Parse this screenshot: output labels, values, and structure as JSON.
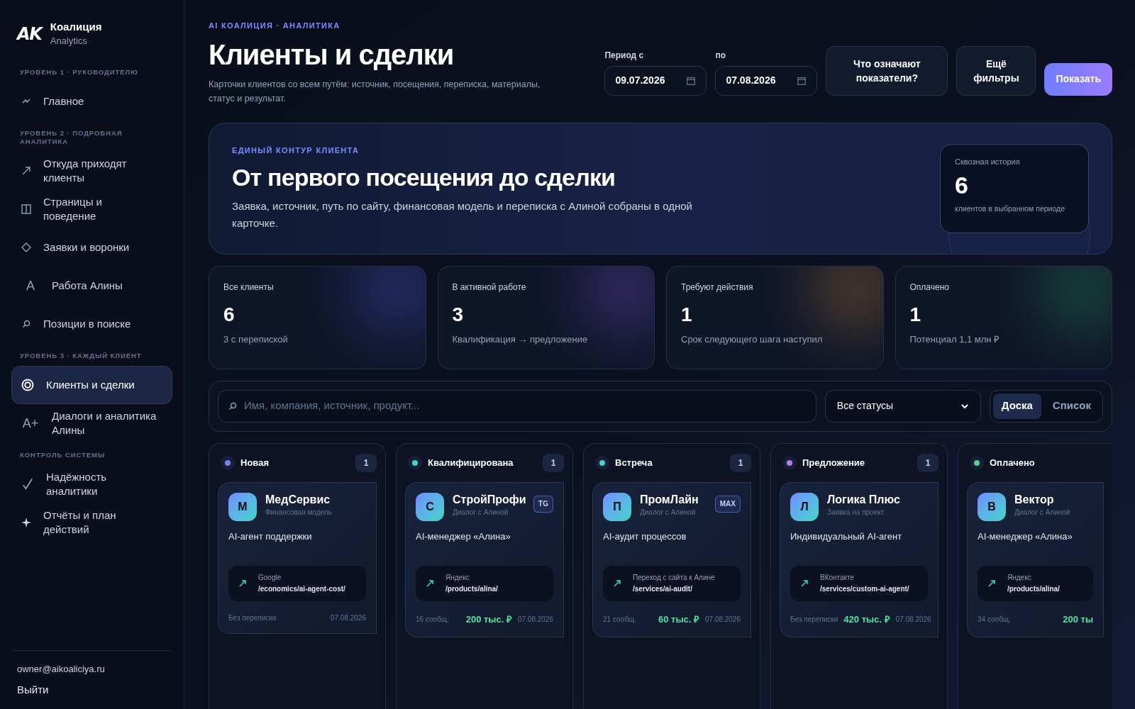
{
  "brand": {
    "logo": "AK",
    "name": "Коалиция",
    "subtitle": "Analytics"
  },
  "sidebar": {
    "sections": [
      {
        "title": "УРОВЕНЬ 1 · РУКОВОДИТЕЛЮ",
        "items": [
          {
            "label": "Главное",
            "selected": false
          }
        ]
      },
      {
        "title": "УРОВЕНЬ 2 · ПОДРОБНАЯ АНАЛИТИКА",
        "items": [
          {
            "label": "Откуда приходят клиенты",
            "selected": false
          },
          {
            "label": "Страницы и поведение",
            "selected": false
          },
          {
            "label": "Заявки и воронки",
            "selected": false
          },
          {
            "glyph": "A",
            "label": "Работа Алины",
            "selected": false
          },
          {
            "label": "Позиции в поиске",
            "selected": false
          }
        ]
      },
      {
        "title": "УРОВЕНЬ 3 · КАЖДЫЙ КЛИЕНТ",
        "items": [
          {
            "label": "Клиенты и сделки",
            "selected": true
          },
          {
            "glyph": "A+",
            "label": "Диалоги и аналитика Алины",
            "selected": false
          }
        ]
      },
      {
        "title": "КОНТРОЛЬ СИСТЕМЫ",
        "items": [
          {
            "label": "Надёжность аналитики",
            "selected": false
          },
          {
            "label": "Отчёты и план действий",
            "selected": false
          }
        ]
      }
    ],
    "user_email": "owner@aikoaliciya.ru",
    "logout": "Выйти"
  },
  "header": {
    "eyebrow": "AI КОАЛИЦИЯ · АНАЛИТИКА",
    "title": "Клиенты и сделки",
    "description": "Карточки клиентов со всем путём: источник, посещения, переписка, материалы, статус и результат.",
    "date_from": {
      "label": "Период с",
      "value": "09.07.2026"
    },
    "date_to": {
      "label": "по",
      "value": "07.08.2026"
    },
    "buttons": [
      {
        "label": "Что означают показатели?",
        "kind": "outline"
      },
      {
        "label": "Ещё фильтры",
        "kind": "outline"
      },
      {
        "label": "Показать",
        "kind": "primary"
      }
    ]
  },
  "hero": {
    "eyebrow": "ЕДИНЫЙ КОНТУР КЛИЕНТА",
    "title": "От первого посещения до сделки",
    "text": "Заявка, источник, путь по сайту, финансовая модель и переписка с Алиной собраны в одной карточке.",
    "stat": {
      "label": "Сквозная история",
      "value": "6",
      "caption": "клиентов в выбранном периоде"
    }
  },
  "metrics": [
    {
      "label": "Все клиенты",
      "value": "6",
      "caption": "3 с перепиской"
    },
    {
      "label": "В активной работе",
      "value": "3",
      "caption": "Квалификация → предложение"
    },
    {
      "label": "Требуют действия",
      "value": "1",
      "caption": "Срок следующего шага наступил"
    },
    {
      "label": "Оплачено",
      "value": "1",
      "caption": "Потенциал 1,1 млн ₽"
    }
  ],
  "filters": {
    "search_placeholder": "Имя, компания, источник, продукт...",
    "status": "Все статусы",
    "views": [
      {
        "label": "Доска",
        "selected": true
      },
      {
        "label": "Список",
        "selected": false
      }
    ]
  },
  "board": [
    {
      "title": "Новая",
      "color": "#7b7ff5",
      "count": "1",
      "cards": [
        {
          "initial": "М",
          "name": "МедСервис",
          "subtitle": "Финансовая модель",
          "product": "AI-агент поддержки",
          "source": "Google",
          "path": "/economics/ai-agent-cost/",
          "messages": "Без переписки",
          "date": "07.08.2026"
        }
      ]
    },
    {
      "title": "Квалифицирована",
      "color": "#3fd5c8",
      "count": "1",
      "cards": [
        {
          "initial": "С",
          "name": "СтройПрофи",
          "subtitle": "Диалог с Алиной",
          "badge": "TG",
          "product": "AI-менеджер «Алина»",
          "source": "Яндекс",
          "path": "/products/alina/",
          "messages": "16 сообщ.",
          "amount": "200 тыс. ₽",
          "date": "07.08.2026"
        }
      ]
    },
    {
      "title": "Встреча",
      "color": "#3fd5c8",
      "count": "1",
      "cards": [
        {
          "initial": "П",
          "name": "ПромЛайн",
          "subtitle": "Диалог с Алиной",
          "badge": "MAX",
          "product": "AI-аудит процессов",
          "source": "Переход с сайта к Алине",
          "path": "/services/ai-audit/",
          "messages": "21 сообщ.",
          "amount": "60 тыс. ₽",
          "date": "07.08.2026"
        }
      ]
    },
    {
      "title": "Предложение",
      "color": "#b57cf5",
      "count": "1",
      "cards": [
        {
          "initial": "Л",
          "name": "Логика Плюс",
          "subtitle": "Заявка на проект",
          "product": "Индивидуальный AI-агент",
          "source": "ВКонтакте",
          "path": "/services/custom-ai-agent/",
          "messages": "Без переписки",
          "amount": "420 тыс. ₽",
          "date": "07.08.2026"
        }
      ]
    },
    {
      "title": "Оплачено",
      "color": "#4fd58a",
      "cards": [
        {
          "initial": "В",
          "name": "Вектор",
          "subtitle": "Диалог с Алиной",
          "product": "AI-менеджер «Алина»",
          "source": "Яндекс",
          "path": "/products/alina/",
          "messages": "34 сообщ.",
          "amount": "200 ты"
        }
      ]
    }
  ]
}
